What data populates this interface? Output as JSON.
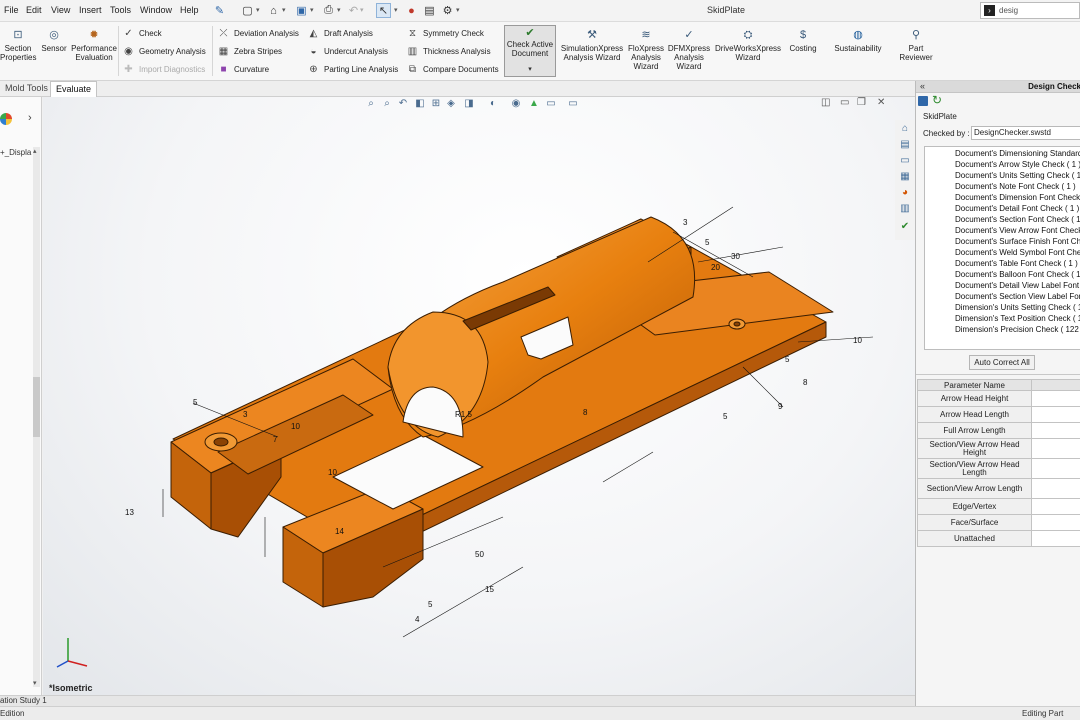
{
  "menubar": {
    "items": [
      "File",
      "Edit",
      "View",
      "Insert",
      "Tools",
      "Window",
      "Help"
    ],
    "document_title": "SkidPlate",
    "search_text": "desig"
  },
  "ribbon": {
    "section_properties": "Section Properties",
    "sensor": "Sensor",
    "performance_evaluation": "Performance Evaluation",
    "check": "Check",
    "geometry_analysis": "Geometry Analysis",
    "import_diagnostics": "Import Diagnostics",
    "deviation_analysis": "Deviation Analysis",
    "zebra_stripes": "Zebra Stripes",
    "curvature": "Curvature",
    "draft_analysis": "Draft Analysis",
    "undercut_analysis": "Undercut Analysis",
    "parting_line_analysis": "Parting Line Analysis",
    "symmetry_check": "Symmetry Check",
    "thickness_analysis": "Thickness Analysis",
    "compare_documents": "Compare Documents",
    "check_active_document": "Check Active Document",
    "simulationxpress": "SimulationXpress Analysis Wizard",
    "floxpress": "FloXpress Analysis Wizard",
    "dfmxpress": "DFMXpress Analysis Wizard",
    "driveworksxpress": "DriveWorksXpress Wizard",
    "costing": "Costing",
    "sustainability": "Sustainability",
    "part_reviewer": "Part Reviewer"
  },
  "tabs": [
    "Mold Tools",
    "Evaluate"
  ],
  "feature_tree": {
    "node_label": "+_Displa"
  },
  "viewport": {
    "view_name": "*Isometric",
    "dimension_labels": [
      "5",
      "30",
      "20",
      "3",
      "10",
      "5",
      "8",
      "9",
      "5",
      "R1.5",
      "8",
      "5",
      "7",
      "10",
      "3",
      "13",
      "10",
      "14",
      "50",
      "15",
      "5",
      "4"
    ]
  },
  "bottom_tab": "ation Study 1",
  "status": {
    "left": "Edition",
    "right": "Editing Part"
  },
  "design_checker": {
    "title": "Design Check",
    "document_name": "SkidPlate",
    "checked_by_label": "Checked by :",
    "standard_file": "DesignChecker.swstd",
    "checks": [
      "Document's Dimensioning Standard",
      "Document's Arrow Style Check ( 1 )",
      "Document's Units Setting Check ( 1 )",
      "Document's Note Font Check ( 1 )",
      "Document's Dimension Font Check",
      "Document's Detail Font Check ( 1 )",
      "Document's Section Font Check ( 1 )",
      "Document's View Arrow Font Check",
      "Document's Surface Finish Font Che",
      "Document's Weld Symbol Font Chec",
      "Document's Table Font Check ( 1 )",
      "Document's Balloon Font Check ( 1",
      "Document's Detail View Label Font",
      "Document's Section View Label Font",
      "Dimension's Units Setting Check ( 1",
      "Dimension's Text Position Check ( 12",
      "Dimension's Precision Check ( 122 )"
    ],
    "auto_correct_label": "Auto Correct All",
    "param_header": "Parameter Name",
    "params": [
      "Arrow Head Height",
      "Arrow Head Length",
      "Full Arrow Length",
      "Section/View Arrow Head Height",
      "Section/View Arrow Head Length",
      "Section/View Arrow Length",
      "Edge/Vertex",
      "Face/Surface",
      "Unattached"
    ]
  },
  "colors": {
    "part_orange": "#e0780e",
    "part_dark": "#a14c05",
    "part_light": "#f39a36",
    "accent_blue": "#2f67a8"
  }
}
